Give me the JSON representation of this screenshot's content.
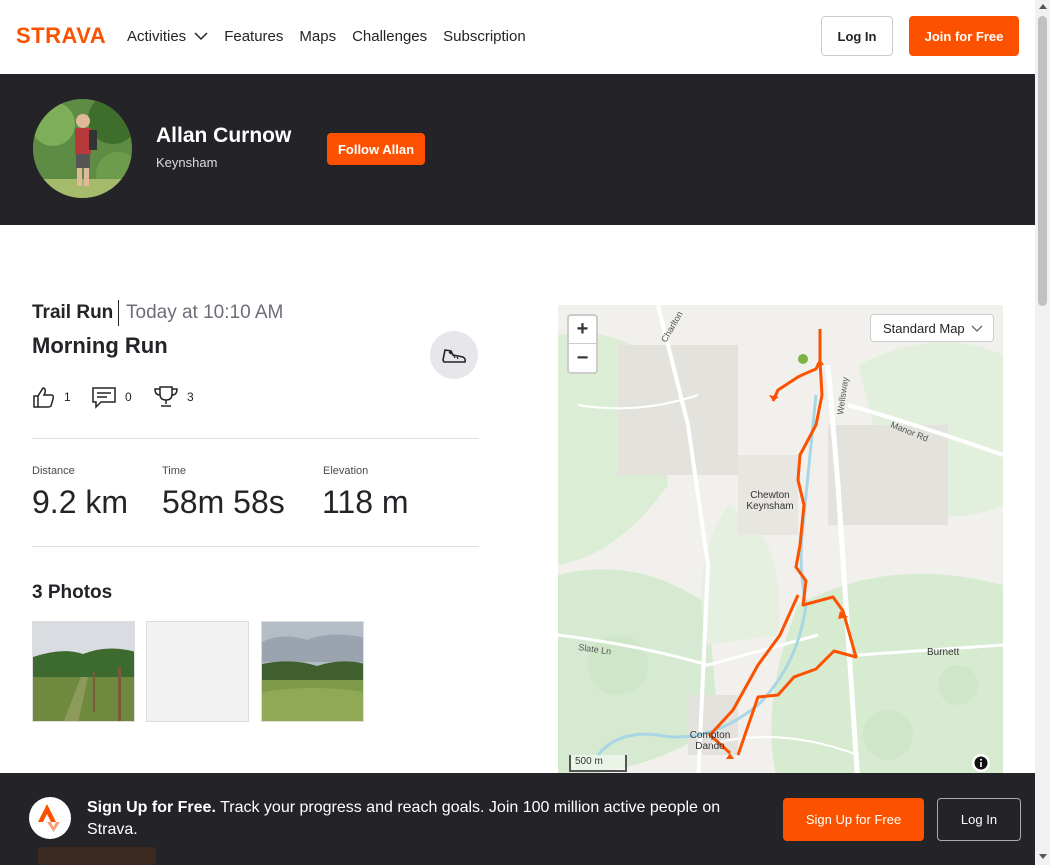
{
  "nav": {
    "brand": "STRAVA",
    "items": [
      {
        "label": "Activities",
        "has_dropdown": true
      },
      {
        "label": "Features"
      },
      {
        "label": "Maps"
      },
      {
        "label": "Challenges"
      },
      {
        "label": "Subscription"
      }
    ],
    "login_label": "Log In",
    "join_label": "Join for Free"
  },
  "athlete": {
    "name": "Allan Curnow",
    "location": "Keynsham",
    "follow_label": "Follow Allan"
  },
  "activity": {
    "type": "Trail Run",
    "time": "Today at 10:10 AM",
    "name": "Morning Run",
    "kudos": "1",
    "comments": "0",
    "achievements": "3",
    "stats": [
      {
        "label": "Distance",
        "value": "9.2 km"
      },
      {
        "label": "Time",
        "value": "58m 58s"
      },
      {
        "label": "Elevation",
        "value": "118 m"
      }
    ],
    "photos_title": "3 Photos"
  },
  "map": {
    "zoom_in": "+",
    "zoom_out": "−",
    "map_type": "Standard Map",
    "scale": "500 m",
    "labels": {
      "chewton": "Chewton",
      "keynsham": "Keynsham",
      "compton": "Compton",
      "dando": "Dando",
      "burnett": "Burnett",
      "slate_ln": "Slate Ln",
      "manor_rd": "Manor Rd",
      "wellsway": "Wellsway",
      "charlton": "Charlton"
    },
    "route_color": "#fc5200"
  },
  "banner": {
    "headline": "Sign Up for Free.",
    "text": "Track your progress and reach goals. Join 100 million active people on Strava.",
    "signup_label": "Sign Up for Free",
    "login_label": "Log In"
  },
  "colors": {
    "brand": "#fc5200",
    "dark": "#242428"
  }
}
